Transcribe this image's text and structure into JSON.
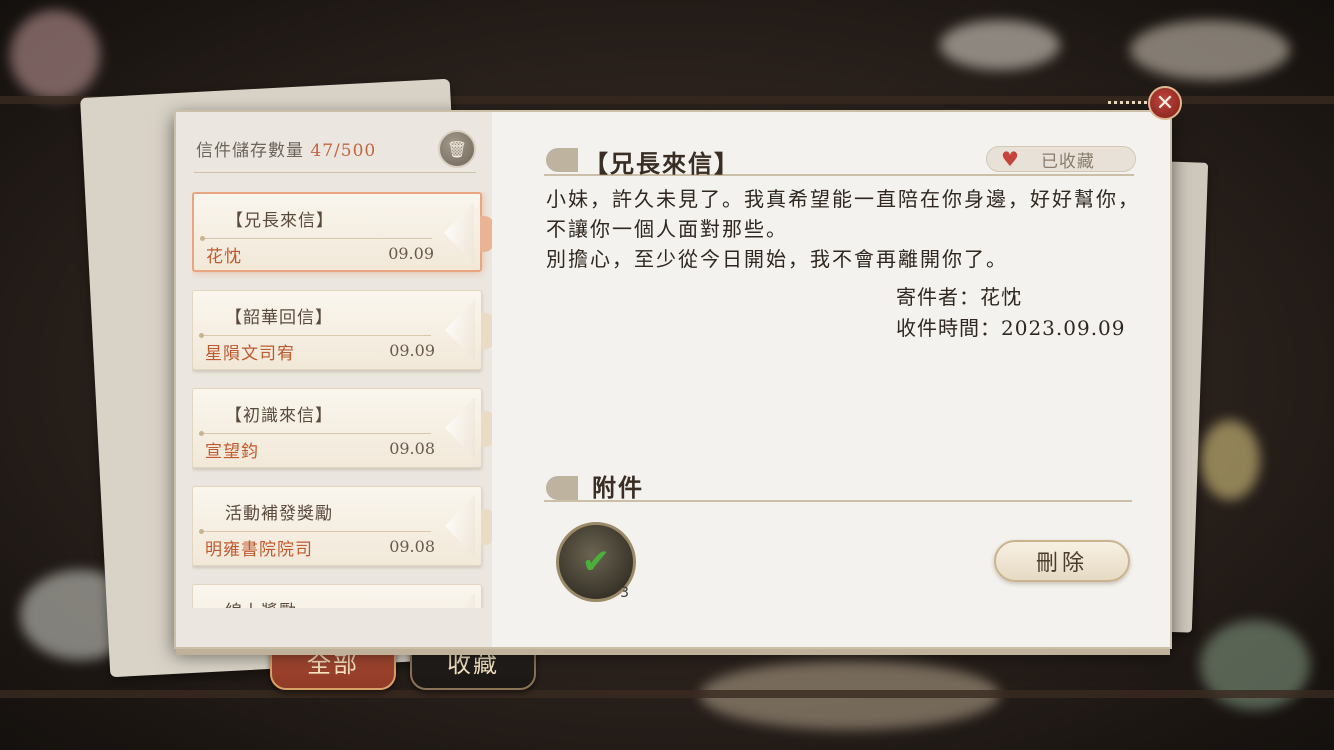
{
  "storage": {
    "label": "信件儲存數量",
    "count": "47/500"
  },
  "mail_list": [
    {
      "title": "【兄長來信】",
      "sender": "花忱",
      "date": "09.09",
      "selected": true
    },
    {
      "title": "【韶華回信】",
      "sender": "星隕文司宥",
      "date": "09.09",
      "selected": false
    },
    {
      "title": "【初識來信】",
      "sender": "宣望鈞",
      "date": "09.08",
      "selected": false
    },
    {
      "title": "活動補發獎勵",
      "sender": "明雍書院院司",
      "date": "09.08",
      "selected": false
    },
    {
      "title": "線上獎勵",
      "sender": "",
      "date": "",
      "selected": false
    }
  ],
  "letter": {
    "title": "【兄長來信】",
    "favorite_label": "已收藏",
    "body": [
      "小妹，許久未見了。我真希望能一直陪在你身邊，好好幫你，不讓你一個人面對那些。",
      "別擔心，至少從今日開始，我不會再離開你了。"
    ],
    "sender_line": "寄件者：花忱",
    "received_line": "收件時間：2023.09.09"
  },
  "attachment": {
    "title": "附件",
    "quantity": "3"
  },
  "buttons": {
    "delete": "刪除"
  },
  "tabs": {
    "all": "全部",
    "favorites": "收藏"
  },
  "colors": {
    "accent": "#c05a2e",
    "close": "#9e2e26",
    "heart": "#c4463a"
  }
}
